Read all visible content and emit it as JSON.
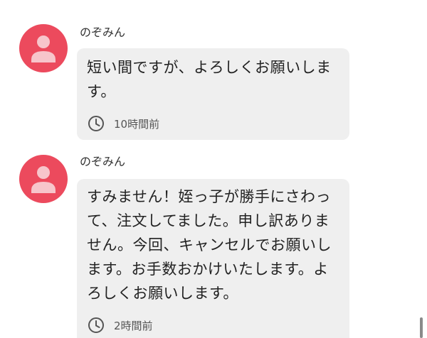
{
  "colors": {
    "avatar_bg": "#ec4a5d",
    "bubble_bg": "#efefef",
    "text": "#222222"
  },
  "messages": [
    {
      "username": "のぞみん",
      "avatar_icon": "user-silhouette-icon",
      "text": "短い間ですが、よろしくお願いします。",
      "time_icon": "clock-icon",
      "time": "10時間前"
    },
    {
      "username": "のぞみん",
      "avatar_icon": "user-silhouette-icon",
      "text": "すみません！姪っ子が勝手にさわって、注文してました。申し訳ありません。今回、キャンセルでお願いします。お手数おかけいたします。よろしくお願いします。",
      "time_icon": "clock-icon",
      "time": "2時間前"
    }
  ]
}
